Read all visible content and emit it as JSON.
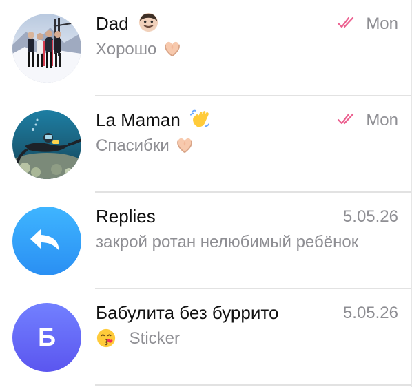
{
  "chats": [
    {
      "name": "Dad",
      "name_emoji": "man-light-skin-tone-emoji",
      "time": "Mon",
      "read_status": "double-check-read",
      "preview": "Хорошо",
      "preview_emoji": "heart-hands-emoji"
    },
    {
      "name": "La Maman",
      "name_emoji": "waving-hand-emoji",
      "time": "Mon",
      "read_status": "double-check-read",
      "preview": "Спасибки",
      "preview_emoji": "heart-hands-emoji"
    },
    {
      "name": "Replies",
      "time": "5.05.26",
      "preview": "закрой ротан нелюбимый ребёнок",
      "avatar_icon": "reply-arrow-icon"
    },
    {
      "name": "Бабулита без буррито",
      "time": "5.05.26",
      "avatar_letter": "Б",
      "preview_emoji": "kissing-face-emoji",
      "preview": "Sticker"
    }
  ],
  "colors": {
    "read_check": "#ec5f8f",
    "title": "#111111",
    "muted": "#8e8e93",
    "replies_avatar_top": "#3fb5ff",
    "replies_avatar_bottom": "#2a8ff3",
    "letter_avatar_top": "#7280ff",
    "letter_avatar_bottom": "#5b56ef"
  }
}
